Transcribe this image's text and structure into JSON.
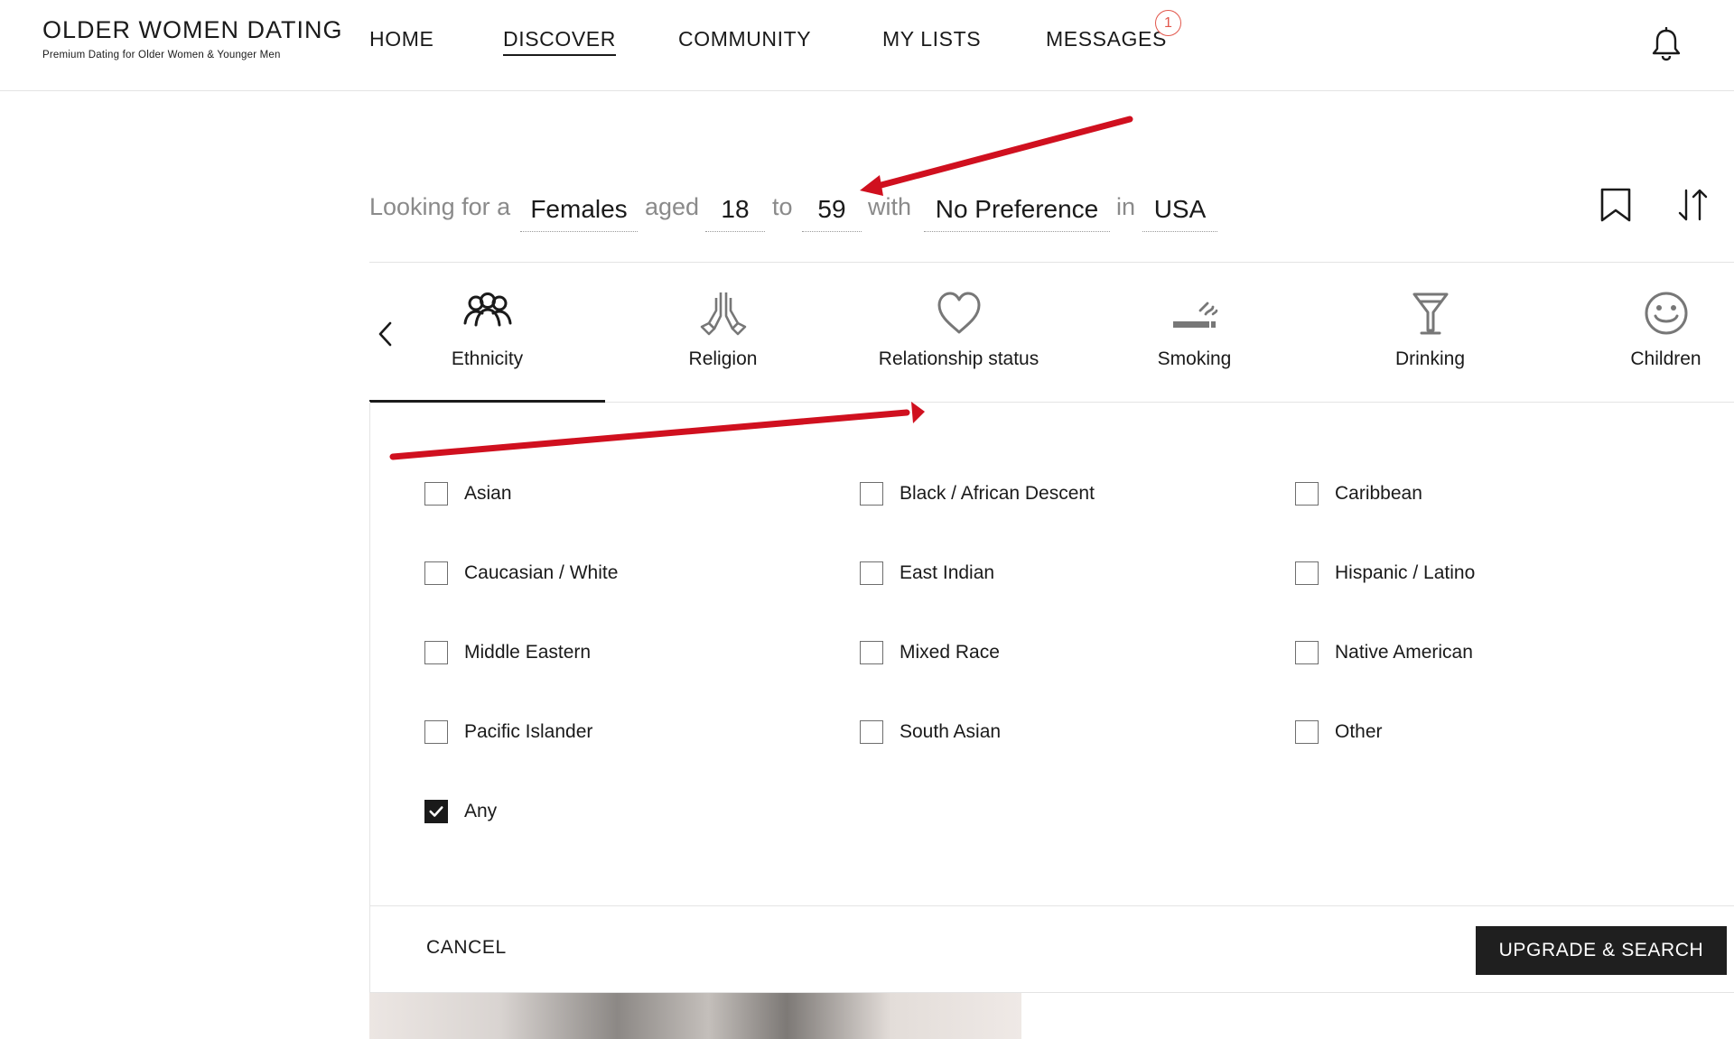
{
  "brand": {
    "title": "OLDER WOMEN DATING",
    "tagline": "Premium Dating for Older Women & Younger Men"
  },
  "nav": {
    "items": [
      {
        "label": "HOME",
        "active": false
      },
      {
        "label": "DISCOVER",
        "active": true
      },
      {
        "label": "COMMUNITY",
        "active": false
      },
      {
        "label": "MY LISTS",
        "active": false
      },
      {
        "label": "MESSAGES",
        "active": false
      }
    ],
    "messages_badge": "1",
    "bell_icon": "bell-icon"
  },
  "search": {
    "looking_for": "Looking for a",
    "gender": "Females",
    "aged": "aged",
    "age_min": "18",
    "to": "to",
    "age_max": "59",
    "with": "with",
    "preference": "No Preference",
    "in": "in",
    "location": "USA",
    "bookmark_icon": "bookmark-icon",
    "sort_icon": "sort-icon"
  },
  "tabs": [
    {
      "label": "Ethnicity",
      "icon": "people-icon",
      "active": true
    },
    {
      "label": "Religion",
      "icon": "praying-hands-icon",
      "active": false
    },
    {
      "label": "Relationship status",
      "icon": "heart-icon",
      "active": false
    },
    {
      "label": "Smoking",
      "icon": "cigarette-icon",
      "active": false
    },
    {
      "label": "Drinking",
      "icon": "cocktail-icon",
      "active": false
    },
    {
      "label": "Children",
      "icon": "smiley-icon",
      "active": false
    }
  ],
  "options": [
    {
      "label": "Asian",
      "checked": false
    },
    {
      "label": "Black / African Descent",
      "checked": false
    },
    {
      "label": "Caribbean",
      "checked": false
    },
    {
      "label": "Caucasian / White",
      "checked": false
    },
    {
      "label": "East Indian",
      "checked": false
    },
    {
      "label": "Hispanic / Latino",
      "checked": false
    },
    {
      "label": "Middle Eastern",
      "checked": false
    },
    {
      "label": "Mixed Race",
      "checked": false
    },
    {
      "label": "Native American",
      "checked": false
    },
    {
      "label": "Pacific Islander",
      "checked": false
    },
    {
      "label": "South Asian",
      "checked": false
    },
    {
      "label": "Other",
      "checked": false
    },
    {
      "label": "Any",
      "checked": true
    }
  ],
  "footer": {
    "cancel_label": "CANCEL",
    "upgrade_label": "UPGRADE & SEARCH"
  },
  "colors": {
    "accent_dark": "#1f1f1f",
    "badge_red": "#e2574c",
    "annotation_red": "#d0101f",
    "muted_text": "#8a8a8a"
  }
}
